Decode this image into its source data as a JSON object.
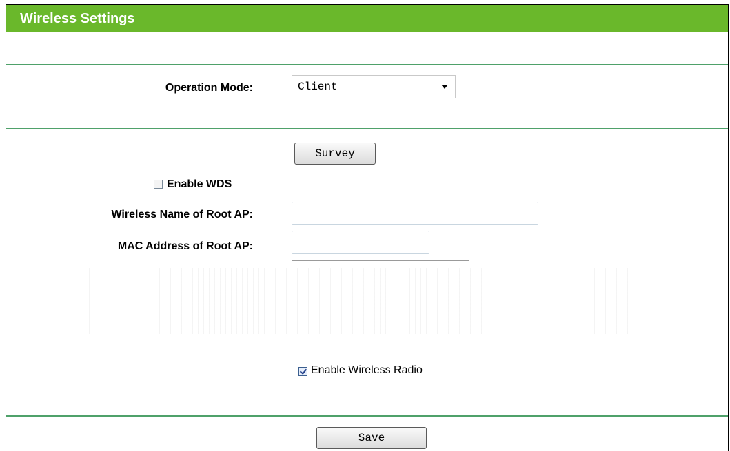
{
  "header": {
    "title": "Wireless Settings"
  },
  "operation_mode": {
    "label": "Operation Mode:",
    "value": "Client"
  },
  "survey": {
    "label": "Survey"
  },
  "wds": {
    "label": "Enable WDS",
    "checked": false
  },
  "root_ap_name": {
    "label": "Wireless Name of Root AP:",
    "value": ""
  },
  "root_ap_mac": {
    "label": "MAC Address of Root AP:",
    "value": ""
  },
  "wireless_radio": {
    "label": "Enable Wireless Radio",
    "checked": true
  },
  "save": {
    "label": "Save"
  },
  "colors": {
    "header": "#6ab82b",
    "separator": "#4fa16a"
  }
}
